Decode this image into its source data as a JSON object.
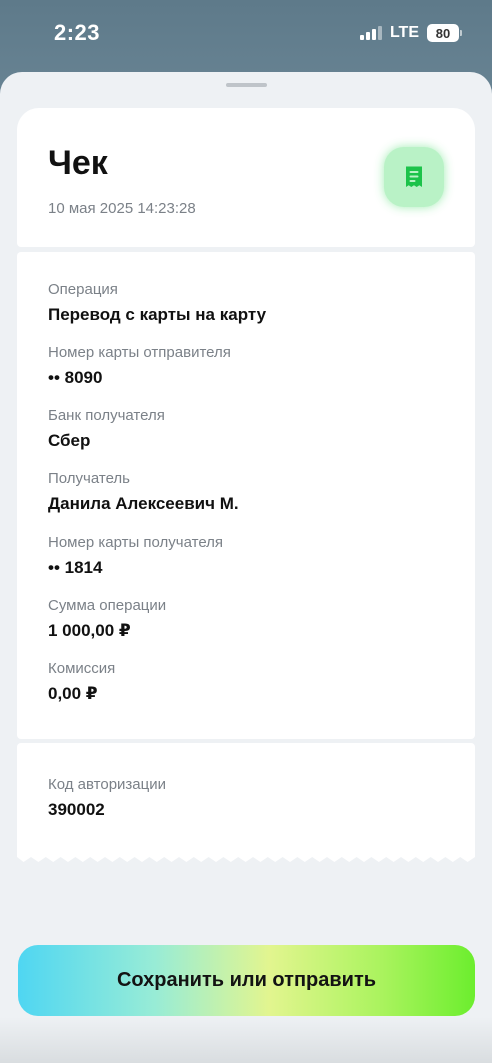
{
  "status_bar": {
    "time": "2:23",
    "network": "LTE",
    "battery": "80"
  },
  "header": {
    "title": "Чек",
    "date": "10 мая 2025 14:23:28",
    "icon": "receipt-icon",
    "icon_color": "#1cc34a"
  },
  "details": [
    {
      "label": "Операция",
      "value": "Перевод с карты на карту"
    },
    {
      "label": "Номер карты отправителя",
      "value": "•• 8090"
    },
    {
      "label": "Банк получателя",
      "value": "Сбер"
    },
    {
      "label": "Получатель",
      "value": "Данила Алексеевич М."
    },
    {
      "label": "Номер карты получателя",
      "value": "•• 1814"
    },
    {
      "label": "Сумма операции",
      "value": "1 000,00 ₽"
    },
    {
      "label": "Комиссия",
      "value": "0,00 ₽"
    }
  ],
  "auth": {
    "label": "Код авторизации",
    "value": "390002"
  },
  "action_button": {
    "label": "Сохранить или отправить"
  }
}
